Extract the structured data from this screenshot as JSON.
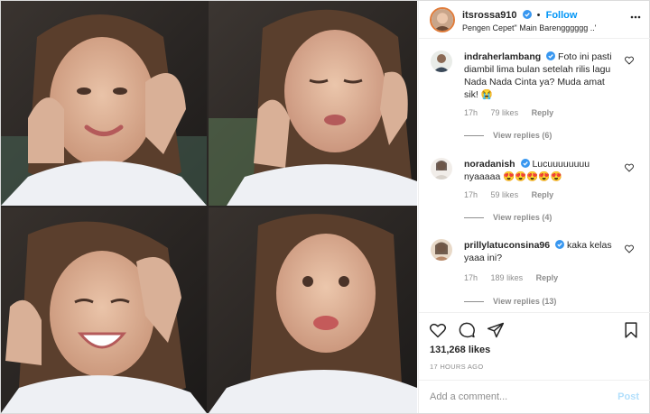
{
  "post": {
    "username": "itsrossa910",
    "follow_separator": "•",
    "follow_label": "Follow",
    "caption": "Pengen Cepet\" Main Barengggggg ..'"
  },
  "comments": [
    {
      "username": "indraherlambang",
      "text": "Foto ini pasti diambil lima bulan setelah rilis lagu Nada Nada Cinta ya? Muda amat sik! 😭",
      "time": "17h",
      "likes": "79 likes",
      "reply": "Reply",
      "view_replies": "View replies (6)"
    },
    {
      "username": "noradanish",
      "text": "Lucuuuuuuuu nyaaaaa 😍😍😍😍😍",
      "time": "17h",
      "likes": "59 likes",
      "reply": "Reply",
      "view_replies": "View replies (4)"
    },
    {
      "username": "prillylatuconsina96",
      "text": "kaka kelas yaaa ini?",
      "time": "17h",
      "likes": "189 likes",
      "reply": "Reply",
      "view_replies": "View replies (13)"
    }
  ],
  "stats": {
    "likes": "131,268 likes",
    "time": "17 HOURS AGO"
  },
  "add_comment": {
    "placeholder": "Add a comment...",
    "post_label": "Post"
  },
  "colors": {
    "accent": "#0095f6",
    "verified": "#3897f0",
    "muted": "#8e8e8e"
  }
}
